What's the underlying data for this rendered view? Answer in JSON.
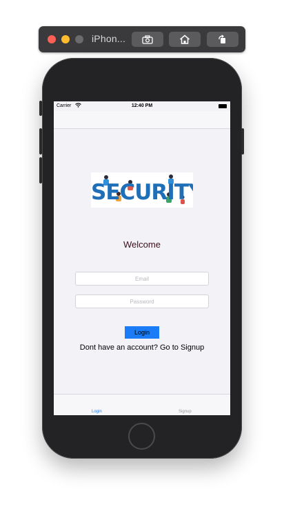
{
  "simulator": {
    "title": "iPhon..."
  },
  "status_bar": {
    "carrier": "Carrier",
    "time": "12:40 PM"
  },
  "logo": {
    "text": "SECURITY"
  },
  "welcome": "Welcome",
  "form": {
    "email_placeholder": "Email",
    "password_placeholder": "Password",
    "login_label": "Login"
  },
  "signup_prompt": "Dont have an account? Go to Signup",
  "tabs": [
    {
      "label": "Login",
      "active": true
    },
    {
      "label": "Signup",
      "active": false
    }
  ],
  "colors": {
    "accent": "#1a7cf7",
    "logo": "#1f6fb8",
    "welcome": "#3a0f1a"
  }
}
